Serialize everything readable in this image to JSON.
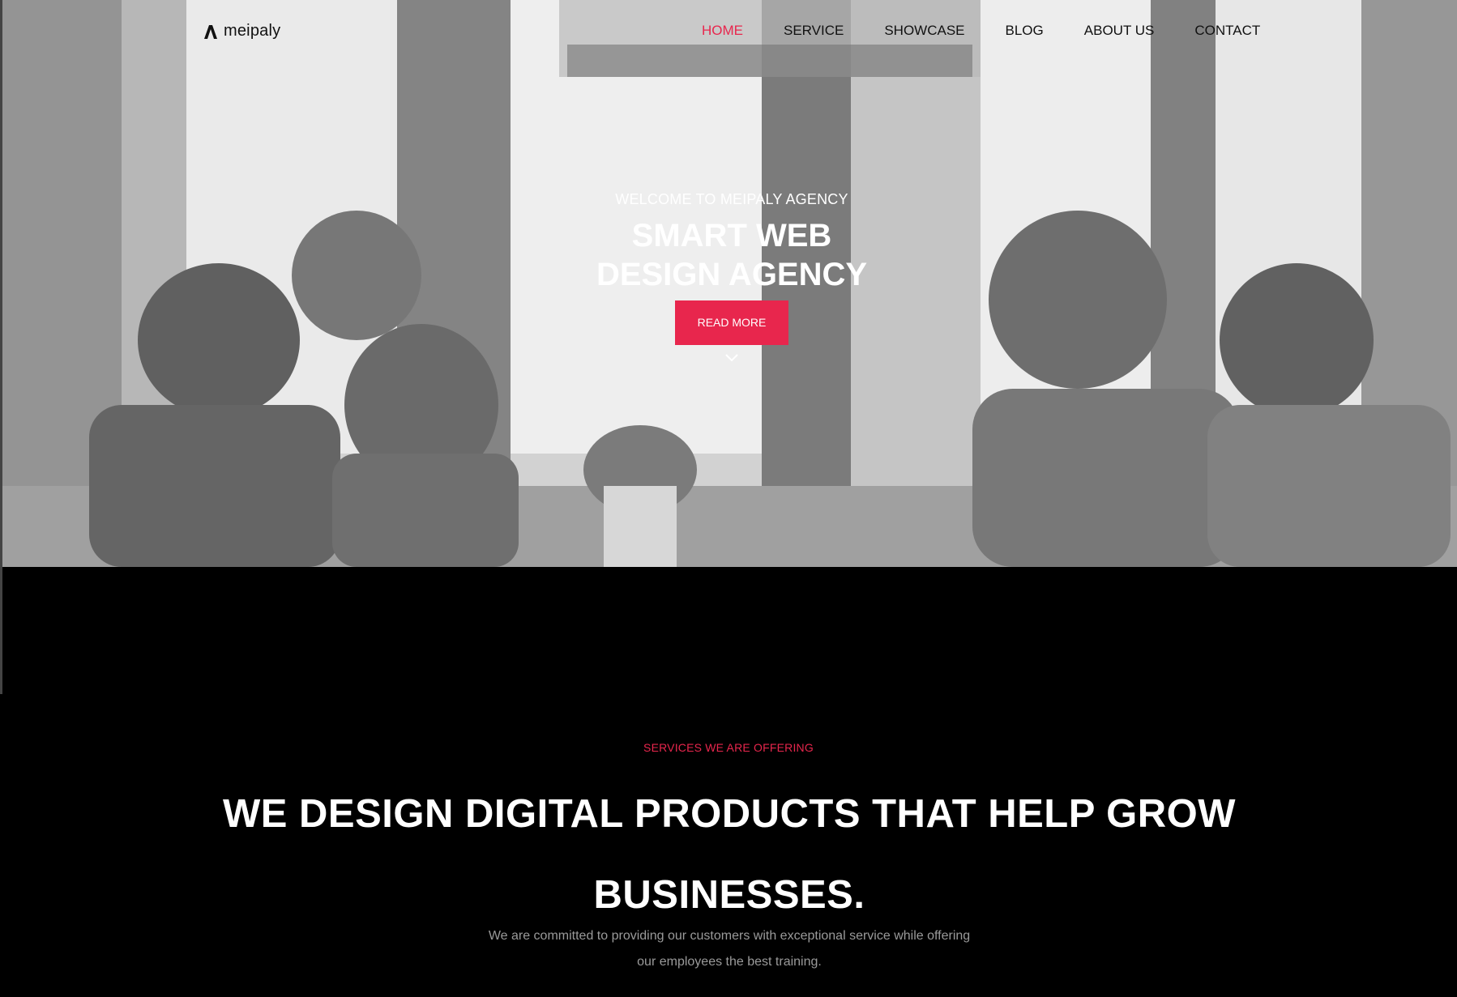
{
  "brand": {
    "name": "meipaly",
    "accent": "#e8264d"
  },
  "nav": {
    "items": [
      {
        "label": "HOME",
        "active": true
      },
      {
        "label": "SERVICE",
        "active": false
      },
      {
        "label": "SHOWCASE",
        "active": false
      },
      {
        "label": "BLOG",
        "active": false
      },
      {
        "label": "ABOUT US",
        "active": false
      },
      {
        "label": "CONTACT",
        "active": false
      }
    ]
  },
  "hero": {
    "kicker": "WELCOME TO MEIPALY AGENCY",
    "title_line1": "SMART WEB",
    "title_line2": "DESIGN AGENCY",
    "cta_label": "READ MORE",
    "scroll_icon": "chevron-down-icon"
  },
  "services": {
    "kicker": "SERVICES WE ARE OFFERING",
    "title": "WE DESIGN DIGITAL PRODUCTS THAT HELP GROW BUSINESSES.",
    "description": "We are committed to providing our customers with exceptional service while offering our employees the best training."
  }
}
